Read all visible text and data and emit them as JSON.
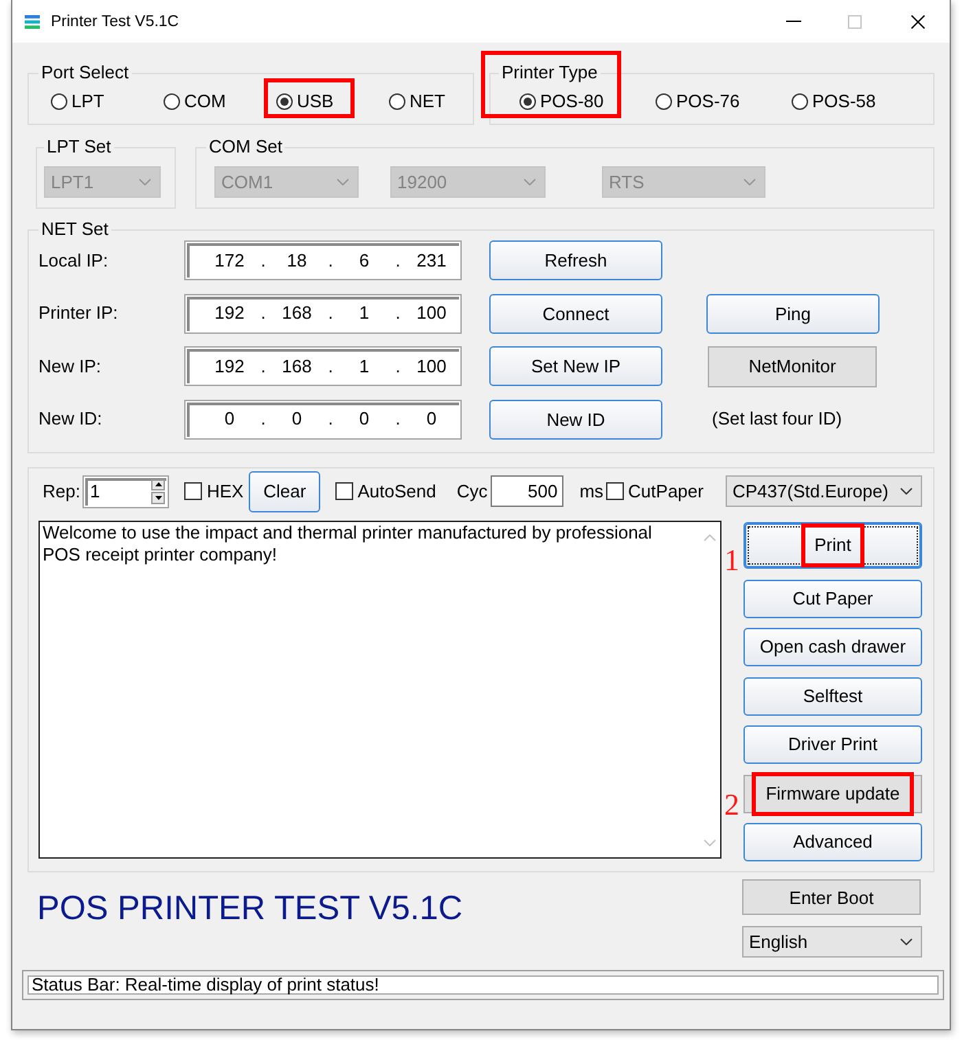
{
  "window": {
    "title": "Printer Test V5.1C",
    "maximize_disabled": true
  },
  "port_select": {
    "title": "Port Select",
    "options": [
      {
        "label": "LPT",
        "selected": false,
        "highlighted": false
      },
      {
        "label": "COM",
        "selected": false,
        "highlighted": false
      },
      {
        "label": "USB",
        "selected": true,
        "highlighted": true
      },
      {
        "label": "NET",
        "selected": false,
        "highlighted": false
      }
    ]
  },
  "printer_type": {
    "title": "Printer Type",
    "highlighted": true,
    "options": [
      {
        "label": "POS-80",
        "selected": true
      },
      {
        "label": "POS-76",
        "selected": false
      },
      {
        "label": "POS-58",
        "selected": false
      }
    ]
  },
  "lpt_set": {
    "title": "LPT Set",
    "selects": [
      {
        "value": "LPT1",
        "disabled": true
      }
    ]
  },
  "com_set": {
    "title": "COM Set",
    "selects": [
      {
        "value": "COM1",
        "disabled": true
      },
      {
        "value": "19200",
        "disabled": true
      },
      {
        "value": "RTS",
        "disabled": true
      }
    ]
  },
  "net_set": {
    "title": "NET Set",
    "separator": ".",
    "rows": [
      {
        "label": "Local IP:",
        "octets": [
          "172",
          "18",
          "6",
          "231"
        ],
        "button": "Refresh"
      },
      {
        "label": "Printer IP:",
        "octets": [
          "192",
          "168",
          "1",
          "100"
        ],
        "button": "Connect",
        "side": {
          "kind": "button",
          "text": "Ping"
        }
      },
      {
        "label": "New IP:",
        "octets": [
          "192",
          "168",
          "1",
          "100"
        ],
        "button": "Set New IP",
        "side": {
          "kind": "flat_button",
          "text": "NetMonitor"
        }
      },
      {
        "label": "New ID:",
        "octets": [
          "0",
          "0",
          "0",
          "0"
        ],
        "button": "New ID",
        "side": {
          "kind": "note",
          "text": "(Set last four ID)"
        }
      }
    ]
  },
  "send": {
    "repeat": {
      "label": "Rep:",
      "value": "1"
    },
    "hex": {
      "label": "HEX",
      "checked": false
    },
    "clear_button": "Clear",
    "auto_send": {
      "label": "AutoSend",
      "checked": false
    },
    "cycle": {
      "label": "Cyc",
      "value": "500",
      "unit": "ms"
    },
    "cut_paper": {
      "label": "CutPaper",
      "checked": false
    },
    "code_page": {
      "value": "CP437(Std.Europe)"
    },
    "message": "Welcome to use the impact and thermal printer manufactured by professional POS receipt printer company!"
  },
  "actions": [
    {
      "label": "Print",
      "kind": "button",
      "focused": true,
      "highlighted": true,
      "step": "1"
    },
    {
      "label": "Cut Paper",
      "kind": "button",
      "focused": false,
      "highlighted": false
    },
    {
      "label": "Open cash drawer",
      "kind": "button",
      "focused": false,
      "highlighted": false
    },
    {
      "label": "Selftest",
      "kind": "button",
      "focused": false,
      "highlighted": false
    },
    {
      "label": "Driver Print",
      "kind": "button",
      "focused": false,
      "highlighted": false
    },
    {
      "label": "Firmware update",
      "kind": "flat_button",
      "focused": false,
      "highlighted": true,
      "step": "2"
    },
    {
      "label": "Advanced",
      "kind": "button",
      "focused": false,
      "highlighted": false
    }
  ],
  "banner": "POS PRINTER TEST V5.1C",
  "footer": {
    "enter_boot": {
      "label": "Enter Boot",
      "kind": "flat_button"
    },
    "language": {
      "value": "English"
    }
  },
  "status_bar": "Status Bar: Real-time display of print status!"
}
